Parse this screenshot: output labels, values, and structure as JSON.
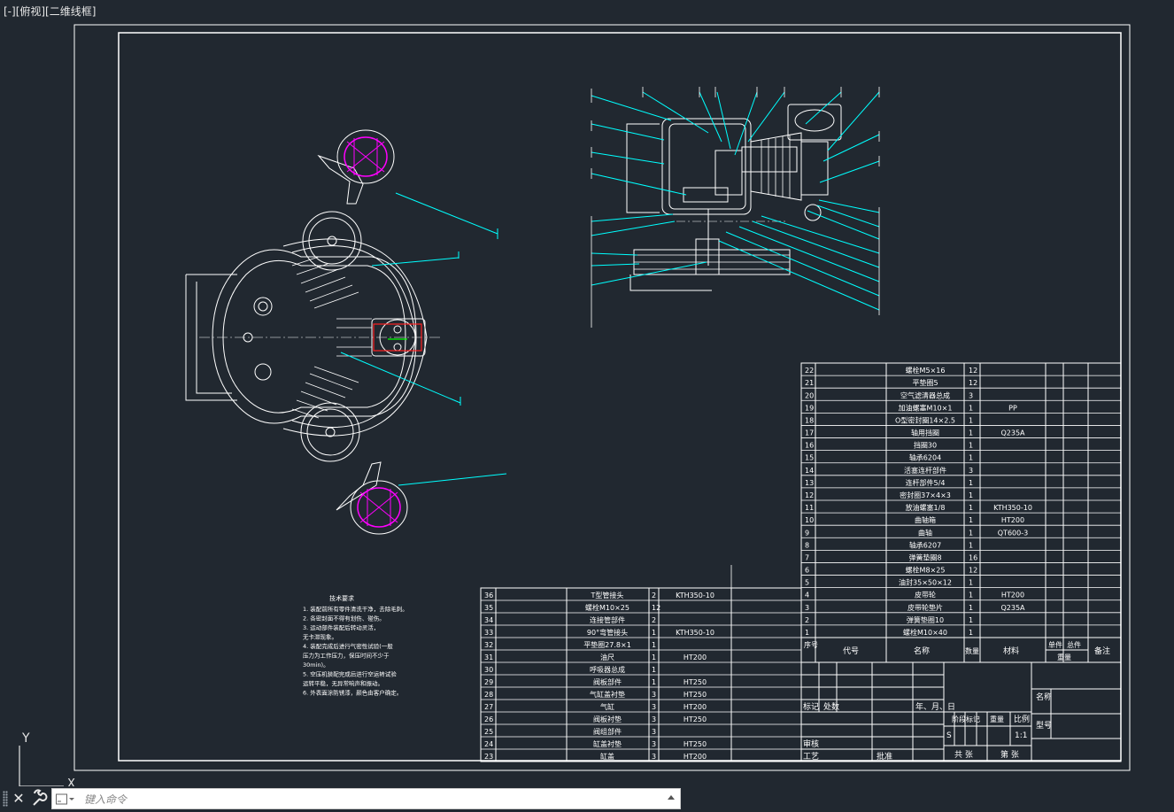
{
  "viewport": {
    "label": "[-][俯视][二维线框]"
  },
  "ucs": {
    "y_label": "Y",
    "x_label": "X"
  },
  "command_line": {
    "placeholder": "键入命令"
  },
  "notes": {
    "title": "技术要求",
    "lines": [
      "1. 装配前所有零件清洗干净，去除毛刺。",
      "2. 各密封面不得有划伤、碰伤。",
      "3. 运动部件装配后转动灵活，",
      "   无卡滞现象。",
      "4. 装配完成后进行气密性试验(一般",
      "   压力为工作压力，保压时间不少于",
      "   30min)。",
      "5. 空压机装配完成后进行空运转试验",
      "   运转平稳，无异常响声和振动。",
      "6. 外表面涂防锈漆，颜色由客户确定。"
    ]
  },
  "bom_upper": [
    {
      "no": "22",
      "name": "螺栓M5×16",
      "qty": "12",
      "mat": ""
    },
    {
      "no": "21",
      "name": "平垫圈5",
      "qty": "12",
      "mat": ""
    },
    {
      "no": "20",
      "name": "空气滤清器总成",
      "qty": "3",
      "mat": ""
    },
    {
      "no": "19",
      "name": "加油螺塞M10×1",
      "qty": "1",
      "mat": "PP"
    },
    {
      "no": "18",
      "name": "O型密封圈14×2.5",
      "qty": "1",
      "mat": ""
    },
    {
      "no": "17",
      "name": "轴用挡圈",
      "qty": "1",
      "mat": "Q235A"
    },
    {
      "no": "16",
      "name": "挡圈30",
      "qty": "1",
      "mat": ""
    },
    {
      "no": "15",
      "name": "轴承6204",
      "qty": "1",
      "mat": ""
    },
    {
      "no": "14",
      "name": "活塞连杆部件",
      "qty": "3",
      "mat": ""
    },
    {
      "no": "13",
      "name": "连杆部件5/4",
      "qty": "1",
      "mat": ""
    },
    {
      "no": "12",
      "name": "密封圈37×4×3",
      "qty": "1",
      "mat": ""
    },
    {
      "no": "11",
      "name": "放油螺塞1/8",
      "qty": "1",
      "mat": "KTH350-10"
    },
    {
      "no": "10",
      "name": "曲轴箱",
      "qty": "1",
      "mat": "HT200"
    },
    {
      "no": "9",
      "name": "曲轴",
      "qty": "1",
      "mat": "QT600-3"
    },
    {
      "no": "8",
      "name": "轴承6207",
      "qty": "1",
      "mat": ""
    },
    {
      "no": "7",
      "name": "弹簧垫圈8",
      "qty": "16",
      "mat": ""
    },
    {
      "no": "6",
      "name": "螺栓M8×25",
      "qty": "12",
      "mat": ""
    },
    {
      "no": "5",
      "name": "油封35×50×12",
      "qty": "1",
      "mat": ""
    },
    {
      "no": "4",
      "name": "皮带轮",
      "qty": "1",
      "mat": "HT200"
    },
    {
      "no": "3",
      "name": "皮带轮垫片",
      "qty": "1",
      "mat": "Q235A"
    },
    {
      "no": "2",
      "name": "弹簧垫圈10",
      "qty": "1",
      "mat": ""
    },
    {
      "no": "1",
      "name": "螺栓M10×40",
      "qty": "1",
      "mat": ""
    }
  ],
  "bom_header": {
    "no": "序号",
    "code": "代号",
    "name": "名称",
    "qty": "数量",
    "mat": "材料",
    "unit": "单件",
    "total": "总件",
    "weight": "重量",
    "remark": "备注"
  },
  "bom_lower": [
    {
      "no": "36",
      "name": "T型管接头",
      "qty": "2",
      "mat": "KTH350-10"
    },
    {
      "no": "35",
      "name": "螺栓M10×25",
      "qty": "12",
      "mat": ""
    },
    {
      "no": "34",
      "name": "连接管部件",
      "qty": "2",
      "mat": ""
    },
    {
      "no": "33",
      "name": "90°弯管接头",
      "qty": "1",
      "mat": "KTH350-10"
    },
    {
      "no": "32",
      "name": "平垫圈27.8×1",
      "qty": "1",
      "mat": ""
    },
    {
      "no": "31",
      "name": "油尺",
      "qty": "1",
      "mat": "HT200"
    },
    {
      "no": "30",
      "name": "呼吸器总成",
      "qty": "1",
      "mat": ""
    },
    {
      "no": "29",
      "name": "阀板部件",
      "qty": "1",
      "mat": "HT250"
    },
    {
      "no": "28",
      "name": "气缸盖衬垫",
      "qty": "3",
      "mat": "HT250"
    },
    {
      "no": "27",
      "name": "气缸",
      "qty": "3",
      "mat": "HT200"
    },
    {
      "no": "26",
      "name": "阀板衬垫",
      "qty": "3",
      "mat": "HT250"
    },
    {
      "no": "25",
      "name": "阀组部件",
      "qty": "3",
      "mat": ""
    },
    {
      "no": "24",
      "name": "缸盖衬垫",
      "qty": "3",
      "mat": "HT250"
    },
    {
      "no": "23",
      "name": "缸盖",
      "qty": "3",
      "mat": "HT200"
    }
  ],
  "title_block": {
    "mark": "标记",
    "places": "处数",
    "date": "年、月、日",
    "stage_mark": "阶段标记",
    "weight": "重量",
    "scale_label": "比例",
    "s_mark": "S",
    "scale": "1:1",
    "review": "审核",
    "process": "工艺",
    "approve": "批准",
    "total_sheets": "共 张",
    "sheet_no": "第 张",
    "name_label": "名称",
    "model_label": "型号"
  },
  "colors": {
    "background": "#212830",
    "lines": "#ffffff",
    "leaders": "#00ffff",
    "magenta": "#ff00ff",
    "red": "#ff2020",
    "green": "#00ff00"
  }
}
